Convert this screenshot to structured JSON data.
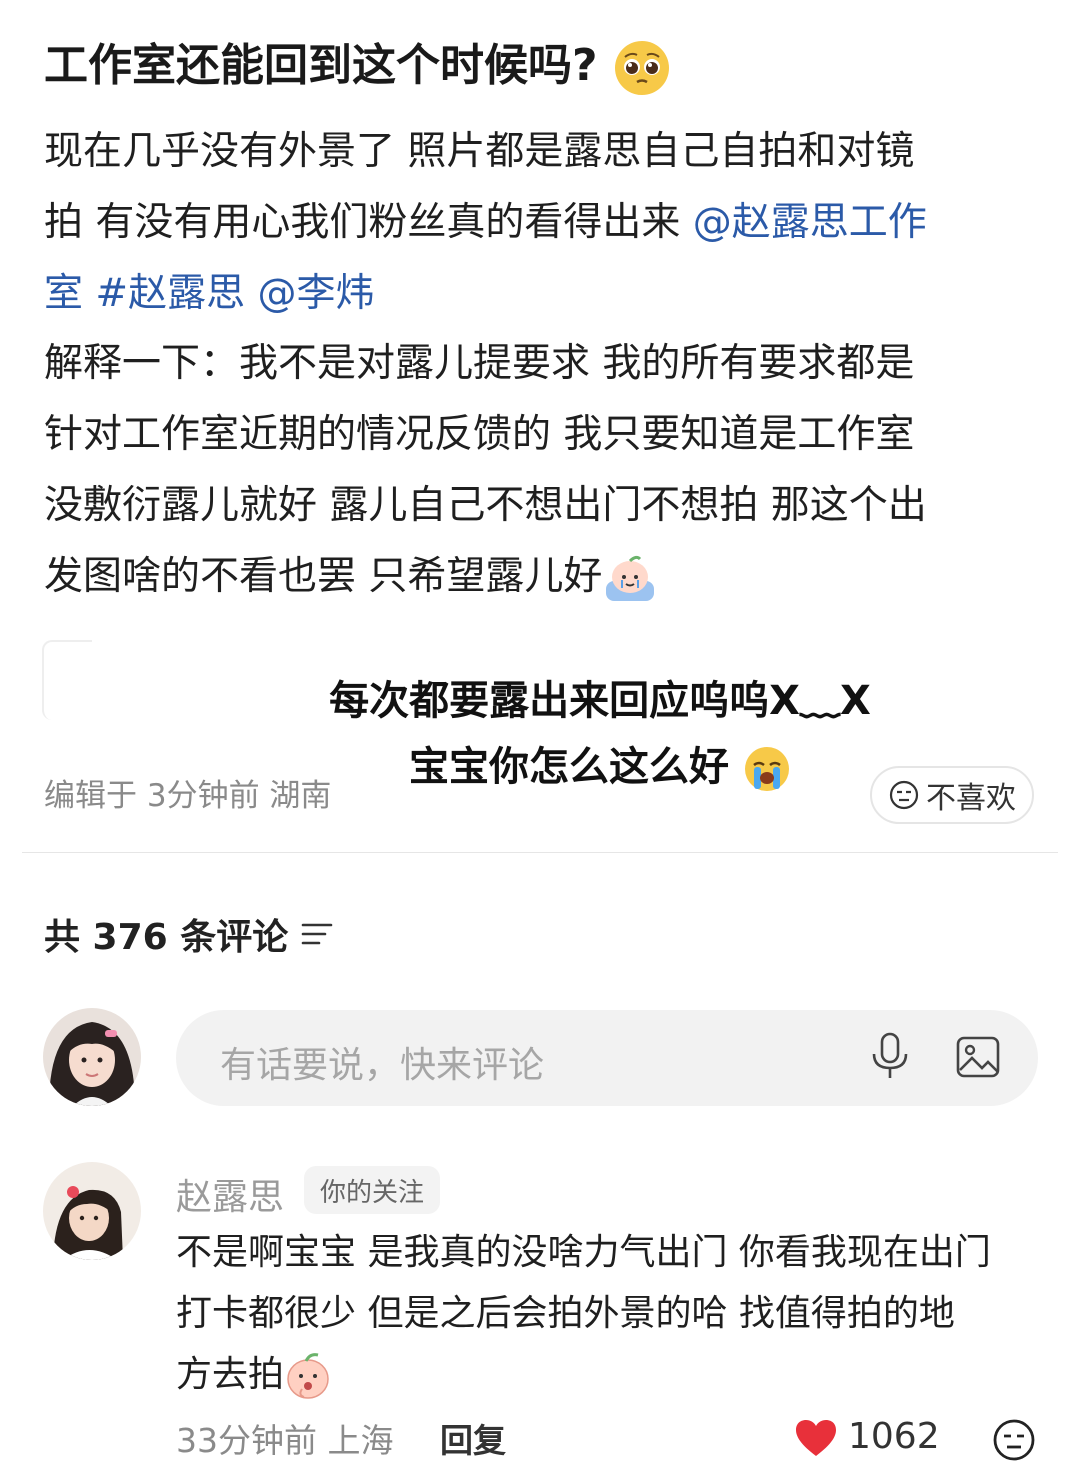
{
  "post": {
    "title": "工作室还能回到这个时候吗?",
    "title_emoji": "pleading-face",
    "paragraph1_lines": [
      "现在几乎没有外景了 照片都是露思自己自拍和对镜",
      "拍 有没有用心我们粉丝真的看得出来 ",
      "室 "
    ],
    "mention1_part_a": "@赵露思工作",
    "mention1_part_b": "室",
    "hashtag": "#赵露思",
    "mention2": "@李炜",
    "paragraph2_lines": [
      "解释一下：我不是对露儿提要求 我的所有要求都是",
      "针对工作室近期的情况反馈的 我只要知道是工作室",
      "没敷衍露儿就好 露儿自己不想出门不想拍 那这个出",
      "发图啥的不看也罢 只希望露儿好"
    ],
    "meta": "编辑于 3分钟前 湖南",
    "dislike_label": "不喜欢"
  },
  "overlay": {
    "line1": "每次都要露出来回应呜呜X﹏X",
    "line2": "宝宝你怎么这么好"
  },
  "comments_header": {
    "label": "共 376 条评论"
  },
  "comment_input": {
    "placeholder": "有话要说，快来评论"
  },
  "comment": {
    "author": "赵露思",
    "badge": "你的关注",
    "text_lines": [
      "不是啊宝宝 是我真的没啥力气出门 你看我现在出门",
      "打卡都很少  但是之后会拍外景的哈 找值得拍的地",
      "方去拍"
    ],
    "meta": "33分钟前 上海",
    "reply_label": "回复",
    "likes": "1062"
  },
  "colors": {
    "link": "#2b5aa8",
    "heart": "#e8303a"
  }
}
